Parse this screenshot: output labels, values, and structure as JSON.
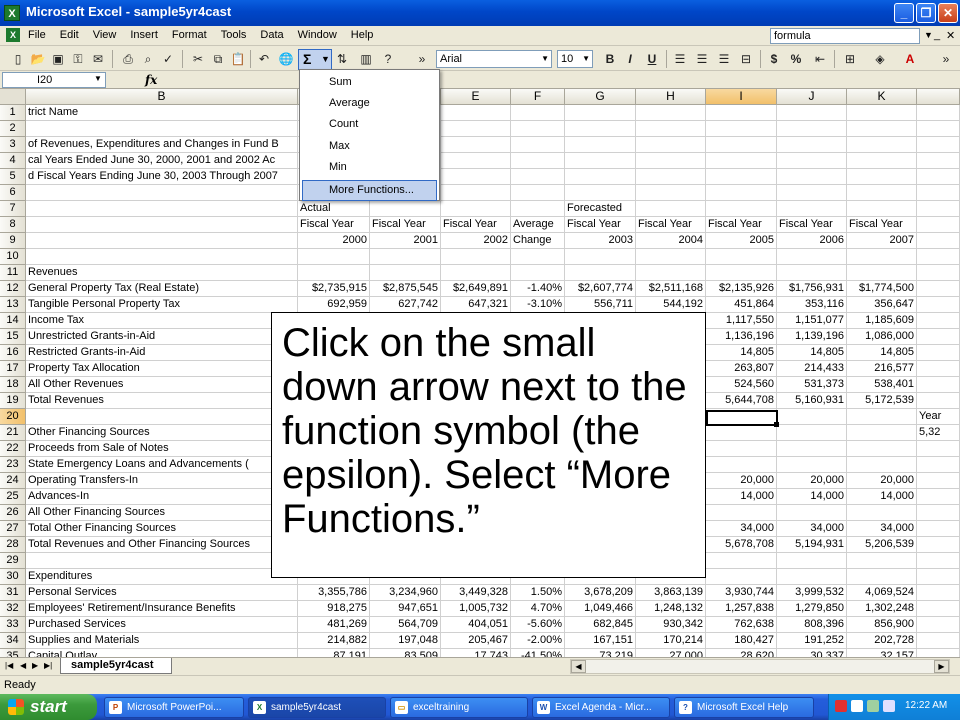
{
  "titlebar": {
    "title": "Microsoft Excel - sample5yr4cast",
    "app_icon": "X"
  },
  "menu": {
    "items": [
      "File",
      "Edit",
      "View",
      "Insert",
      "Format",
      "Tools",
      "Data",
      "Window",
      "Help"
    ],
    "help_box": "formula"
  },
  "toolbar": {
    "font_name": "Arial",
    "font_size": "10",
    "sigma": "Σ",
    "bold": "B",
    "italic": "I",
    "underline": "U"
  },
  "formula_bar": {
    "name_box": "I20",
    "fx": "fx"
  },
  "columns": [
    "B",
    "C",
    "D",
    "E",
    "F",
    "G",
    "H",
    "I",
    "J",
    "K"
  ],
  "rows": [
    {
      "n": "1",
      "b": "trict Name",
      "c": "",
      "d": "",
      "e": "",
      "f": "",
      "g": "",
      "h": "",
      "i": "",
      "j": "",
      "k": "",
      "l": ""
    },
    {
      "n": "2",
      "b": "",
      "c": "",
      "d": "",
      "e": "",
      "f": "",
      "g": "",
      "h": "",
      "i": "",
      "j": "",
      "k": "",
      "l": ""
    },
    {
      "n": "3",
      "b": "of Revenues, Expenditures and Changes in Fund B",
      "c": "",
      "d": "",
      "e": "",
      "f": "",
      "g": "",
      "h": "",
      "i": "",
      "j": "",
      "k": "",
      "l": ""
    },
    {
      "n": "4",
      "b": "cal Years Ended June 30, 2000, 2001 and 2002 Ac",
      "c": "",
      "d": "",
      "e": "",
      "f": "",
      "g": "",
      "h": "",
      "i": "",
      "j": "",
      "k": "",
      "l": ""
    },
    {
      "n": "5",
      "b": "d Fiscal Years Ending June 30, 2003 Through 2007",
      "c": "",
      "d": "",
      "e": "",
      "f": "",
      "g": "",
      "h": "",
      "i": "",
      "j": "",
      "k": "",
      "l": ""
    },
    {
      "n": "6",
      "b": "",
      "c": "",
      "d": "",
      "e": "",
      "f": "",
      "g": "",
      "h": "",
      "i": "",
      "j": "",
      "k": "",
      "l": ""
    },
    {
      "n": "7",
      "b": "",
      "c": "Actual",
      "d": "",
      "e": "",
      "f": "",
      "g": "Forecasted",
      "h": "",
      "i": "",
      "j": "",
      "k": "",
      "l": ""
    },
    {
      "n": "8",
      "b": "",
      "c": "Fiscal Year",
      "d": "Fiscal Year",
      "e": "Fiscal Year",
      "f": "Average",
      "g": "Fiscal Year",
      "h": "Fiscal Year",
      "i": "Fiscal Year",
      "j": "Fiscal Year",
      "k": "Fiscal Year",
      "l": ""
    },
    {
      "n": "9",
      "b": "",
      "c": "2000",
      "d": "2001",
      "e": "2002",
      "f": "Change",
      "g": "2003",
      "h": "2004",
      "i": "2005",
      "j": "2006",
      "k": "2007",
      "l": ""
    },
    {
      "n": "10",
      "b": "",
      "c": "",
      "d": "",
      "e": "",
      "f": "",
      "g": "",
      "h": "",
      "i": "",
      "j": "",
      "k": "",
      "l": ""
    },
    {
      "n": "11",
      "b": "Revenues",
      "c": "",
      "d": "",
      "e": "",
      "f": "",
      "g": "",
      "h": "",
      "i": "",
      "j": "",
      "k": "",
      "l": ""
    },
    {
      "n": "12",
      "b": "General Property Tax (Real Estate)",
      "c": "$2,735,915",
      "d": "$2,875,545",
      "e": "$2,649,891",
      "f": "-1.40%",
      "g": "$2,607,774",
      "h": "$2,511,168",
      "i": "$2,135,926",
      "j": "$1,756,931",
      "k": "$1,774,500",
      "l": ""
    },
    {
      "n": "13",
      "b": "Tangible Personal Property Tax",
      "c": "692,959",
      "d": "627,742",
      "e": "647,321",
      "f": "-3.10%",
      "g": "556,711",
      "h": "544,192",
      "i": "451,864",
      "j": "353,116",
      "k": "356,647",
      "l": ""
    },
    {
      "n": "14",
      "b": "Income Tax",
      "c": "",
      "d": "",
      "e": "",
      "f": "",
      "g": "",
      "h": "",
      "i": "1,117,550",
      "j": "1,151,077",
      "k": "1,185,609",
      "l": ""
    },
    {
      "n": "15",
      "b": "Unrestricted Grants-in-Aid",
      "c": "",
      "d": "",
      "e": "",
      "f": "",
      "g": "",
      "h": "",
      "i": "1,136,196",
      "j": "1,139,196",
      "k": "1,086,000",
      "l": ""
    },
    {
      "n": "16",
      "b": "Restricted Grants-in-Aid",
      "c": "",
      "d": "",
      "e": "",
      "f": "",
      "g": "",
      "h": "",
      "i": "14,805",
      "j": "14,805",
      "k": "14,805",
      "l": ""
    },
    {
      "n": "17",
      "b": "Property Tax Allocation",
      "c": "",
      "d": "",
      "e": "",
      "f": "",
      "g": "",
      "h": "",
      "i": "263,807",
      "j": "214,433",
      "k": "216,577",
      "l": ""
    },
    {
      "n": "18",
      "b": "All Other Revenues",
      "c": "",
      "d": "",
      "e": "",
      "f": "",
      "g": "",
      "h": "",
      "i": "524,560",
      "j": "531,373",
      "k": "538,401",
      "l": ""
    },
    {
      "n": "19",
      "b": "Total Revenues",
      "c": "",
      "d": "",
      "e": "",
      "f": "",
      "g": "",
      "h": "",
      "i": "5,644,708",
      "j": "5,160,931",
      "k": "5,172,539",
      "l": ""
    },
    {
      "n": "20",
      "b": "",
      "c": "",
      "d": "",
      "e": "",
      "f": "",
      "g": "",
      "h": "",
      "i": "",
      "j": "",
      "k": "",
      "l": "Year"
    },
    {
      "n": "21",
      "b": "Other Financing Sources",
      "c": "",
      "d": "",
      "e": "",
      "f": "",
      "g": "",
      "h": "",
      "i": "",
      "j": "",
      "k": "",
      "l": "5,32"
    },
    {
      "n": "22",
      "b": "Proceeds from Sale of Notes",
      "c": "",
      "d": "",
      "e": "",
      "f": "",
      "g": "",
      "h": "",
      "i": "",
      "j": "",
      "k": "",
      "l": ""
    },
    {
      "n": "23",
      "b": "State Emergency Loans and Advancements (",
      "c": "",
      "d": "",
      "e": "",
      "f": "",
      "g": "",
      "h": "",
      "i": "",
      "j": "",
      "k": "",
      "l": ""
    },
    {
      "n": "24",
      "b": "Operating Transfers-In",
      "c": "",
      "d": "",
      "e": "",
      "f": "",
      "g": "",
      "h": "",
      "i": "20,000",
      "j": "20,000",
      "k": "20,000",
      "l": ""
    },
    {
      "n": "25",
      "b": "Advances-In",
      "c": "",
      "d": "",
      "e": "",
      "f": "",
      "g": "",
      "h": "",
      "i": "14,000",
      "j": "14,000",
      "k": "14,000",
      "l": ""
    },
    {
      "n": "26",
      "b": "All Other Financing Sources",
      "c": "",
      "d": "",
      "e": "",
      "f": "",
      "g": "",
      "h": "",
      "i": "",
      "j": "",
      "k": "",
      "l": ""
    },
    {
      "n": "27",
      "b": "Total Other Financing Sources",
      "c": "",
      "d": "",
      "e": "",
      "f": "",
      "g": "",
      "h": "",
      "i": "34,000",
      "j": "34,000",
      "k": "34,000",
      "l": ""
    },
    {
      "n": "28",
      "b": "Total Revenues and Other Financing Sources",
      "c": "",
      "d": "",
      "e": "",
      "f": "",
      "g": "",
      "h": "",
      "i": "5,678,708",
      "j": "5,194,931",
      "k": "5,206,539",
      "l": ""
    },
    {
      "n": "29",
      "b": "",
      "c": "",
      "d": "",
      "e": "",
      "f": "",
      "g": "",
      "h": "",
      "i": "",
      "j": "",
      "k": "",
      "l": ""
    },
    {
      "n": "30",
      "b": "Expenditures",
      "c": "",
      "d": "",
      "e": "",
      "f": "",
      "g": "",
      "h": "",
      "i": "",
      "j": "",
      "k": "",
      "l": ""
    },
    {
      "n": "31",
      "b": "Personal Services",
      "c": "3,355,786",
      "d": "3,234,960",
      "e": "3,449,328",
      "f": "1.50%",
      "g": "3,678,209",
      "h": "3,863,139",
      "i": "3,930,744",
      "j": "3,999,532",
      "k": "4,069,524",
      "l": ""
    },
    {
      "n": "32",
      "b": "Employees' Retirement/Insurance Benefits",
      "c": "918,275",
      "d": "947,651",
      "e": "1,005,732",
      "f": "4.70%",
      "g": "1,049,466",
      "h": "1,248,132",
      "i": "1,257,838",
      "j": "1,279,850",
      "k": "1,302,248",
      "l": ""
    },
    {
      "n": "33",
      "b": "Purchased Services",
      "c": "481,269",
      "d": "564,709",
      "e": "404,051",
      "f": "-5.60%",
      "g": "682,845",
      "h": "930,342",
      "i": "762,638",
      "j": "808,396",
      "k": "856,900",
      "l": ""
    },
    {
      "n": "34",
      "b": "Supplies and Materials",
      "c": "214,882",
      "d": "197,048",
      "e": "205,467",
      "f": "-2.00%",
      "g": "167,151",
      "h": "170,214",
      "i": "180,427",
      "j": "191,252",
      "k": "202,728",
      "l": ""
    },
    {
      "n": "35",
      "b": "Capital Outlay",
      "c": "87,191",
      "d": "83,509",
      "e": "17,743",
      "f": "-41.50%",
      "g": "73,219",
      "h": "27,000",
      "i": "28,620",
      "j": "30,337",
      "k": "32,157",
      "l": ""
    }
  ],
  "dropdown": {
    "items": [
      "Sum",
      "Average",
      "Count",
      "Max",
      "Min",
      "More Functions..."
    ]
  },
  "callout": {
    "text": "Click on the small down arrow next to the function symbol (the epsilon).  Select “More Functions.”"
  },
  "sheet_tab": "sample5yr4cast",
  "status": "Ready",
  "taskbar": {
    "start": "start",
    "tasks": [
      "Microsoft PowerPoi...",
      "sample5yr4cast",
      "exceltraining",
      "Excel Agenda - Micr...",
      "Microsoft Excel Help"
    ],
    "clock": "12:22 AM"
  }
}
